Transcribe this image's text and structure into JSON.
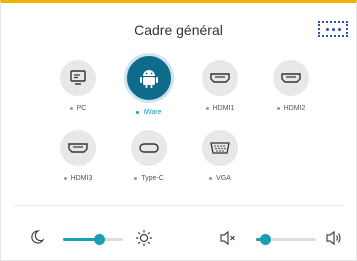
{
  "window": {
    "title": "Cadre général"
  },
  "sources": [
    {
      "label": "PC",
      "icon": "monitor-icon",
      "active": false
    },
    {
      "label": "iWare",
      "icon": "android-icon",
      "active": true
    },
    {
      "label": "HDMI1",
      "icon": "hdmi-port-icon",
      "active": false
    },
    {
      "label": "HDMI2",
      "icon": "hdmi-port-icon",
      "active": false
    },
    {
      "label": "HDMI3",
      "icon": "hdmi-port-icon",
      "active": false
    },
    {
      "label": "Type-C",
      "icon": "usb-c-port-icon",
      "active": false
    },
    {
      "label": "VGA",
      "icon": "vga-port-icon",
      "active": false
    }
  ],
  "brightness": {
    "level": 0.6,
    "low_icon": "moon-icon",
    "high_icon": "sun-icon"
  },
  "volume": {
    "level": 0.15,
    "mute_icon": "speaker-mute-icon",
    "loud_icon": "speaker-loud-icon"
  },
  "colors": {
    "accent": "#1a9fb0",
    "active_source": "#0e6b89",
    "highlight_border": "#2b4fb3",
    "top_bar": "#f0b400"
  }
}
